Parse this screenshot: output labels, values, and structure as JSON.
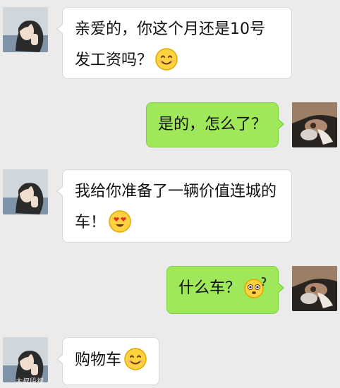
{
  "messages": [
    {
      "side": "left",
      "text": "亲爱的，你这个月还是10号发工资吗？",
      "emoji": "smile-emoji"
    },
    {
      "side": "right",
      "text": "是的，怎么了？"
    },
    {
      "side": "left",
      "text": "我给你准备了一辆价值连城的车！",
      "emoji": "heart-eyes-emoji"
    },
    {
      "side": "right",
      "text": "什么车？",
      "emoji": "confused-emoji"
    },
    {
      "side": "left",
      "text": "购物车",
      "emoji": "smile-emoji"
    }
  ],
  "watermark": "大叔段视",
  "colors": {
    "background": "#ebebeb",
    "incoming_bubble": "#ffffff",
    "outgoing_bubble": "#9fe85a"
  }
}
